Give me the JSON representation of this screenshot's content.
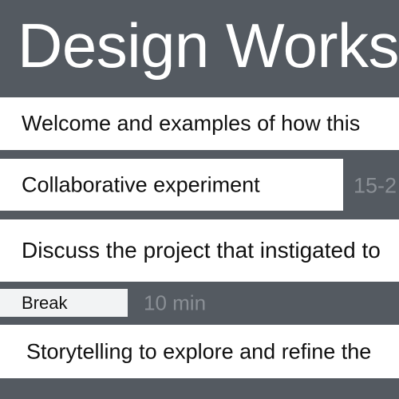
{
  "header": {
    "title": "Design Works"
  },
  "agenda": {
    "items": [
      {
        "label": "Welcome and examples of how this"
      },
      {
        "label": "Collaborative experiment",
        "duration": "15-2"
      },
      {
        "label": "Discuss the project that instigated to"
      },
      {
        "label": "Break",
        "duration": "10 min"
      },
      {
        "label": "Storytelling to explore and refine the"
      }
    ]
  },
  "colors": {
    "background": "#545a61",
    "bar": "#ffffff",
    "break_bar": "#f2f3f4",
    "duration_text": "#8a8f95"
  }
}
